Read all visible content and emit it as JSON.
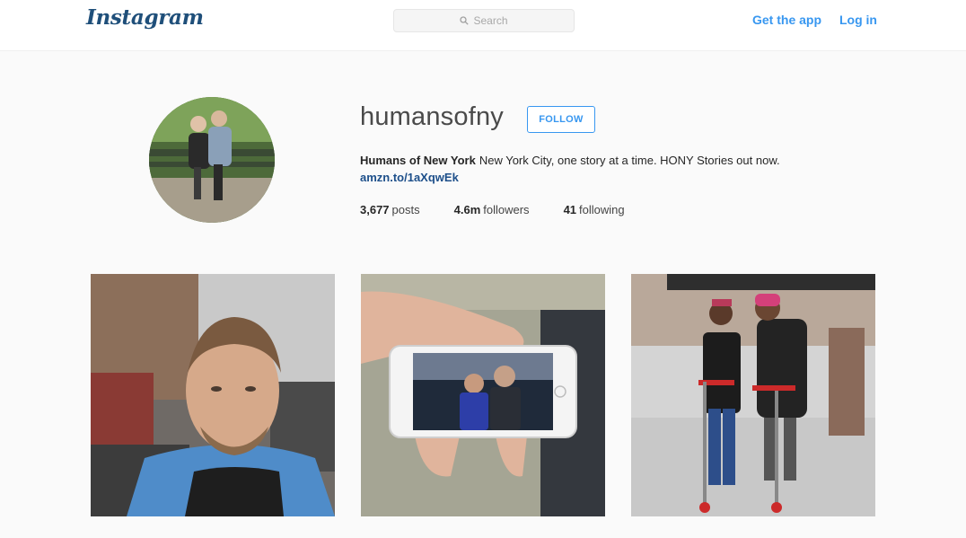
{
  "header": {
    "logo": "Instagram",
    "search_placeholder": "Search",
    "get_app": "Get the app",
    "login": "Log in"
  },
  "profile": {
    "username": "humansofny",
    "follow_label": "FOLLOW",
    "full_name": "Humans of New York",
    "bio": "New York City, one story at a time. HONY Stories out now.",
    "link": "amzn.to/1aXqwEk",
    "stats": {
      "posts_count": "3,677",
      "posts_label": "posts",
      "followers_count": "4.6m",
      "followers_label": "followers",
      "following_count": "41",
      "following_label": "following"
    }
  },
  "colors": {
    "accent": "#3897f0",
    "link_dark": "#1d4f8a",
    "background": "#fafafa"
  },
  "icons": {
    "search": "search-icon"
  },
  "posts": [
    {
      "subject": "man in blue hoodie on city street"
    },
    {
      "subject": "hand holding phone showing two people"
    },
    {
      "subject": "two people with scooters on sidewalk"
    }
  ]
}
